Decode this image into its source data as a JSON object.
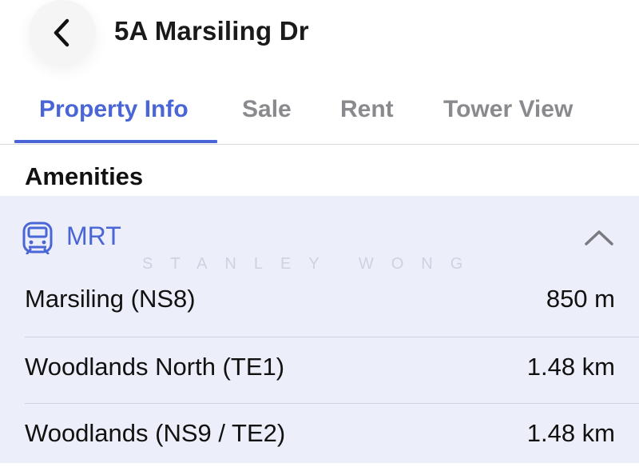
{
  "header": {
    "title": "5A Marsiling Dr",
    "back_icon": "chevron-left-icon"
  },
  "tabs": [
    {
      "label": "Property Info",
      "active": true
    },
    {
      "label": "Sale",
      "active": false
    },
    {
      "label": "Rent",
      "active": false
    },
    {
      "label": "Tower View",
      "active": false
    }
  ],
  "section": {
    "title": "Amenities"
  },
  "mrt_panel": {
    "title": "MRT",
    "icon": "train-icon",
    "expanded": true,
    "watermark": "STANLEY WONG",
    "rows": [
      {
        "name": "Marsiling (NS8)",
        "distance": "850 m"
      },
      {
        "name": "Woodlands North (TE1)",
        "distance": "1.48 km"
      },
      {
        "name": "Woodlands (NS9 / TE2)",
        "distance": "1.48 km"
      }
    ]
  },
  "colors": {
    "accent": "#4a66d6",
    "panel_bg": "#eceef9",
    "inactive_tab": "#8a8a8e"
  }
}
